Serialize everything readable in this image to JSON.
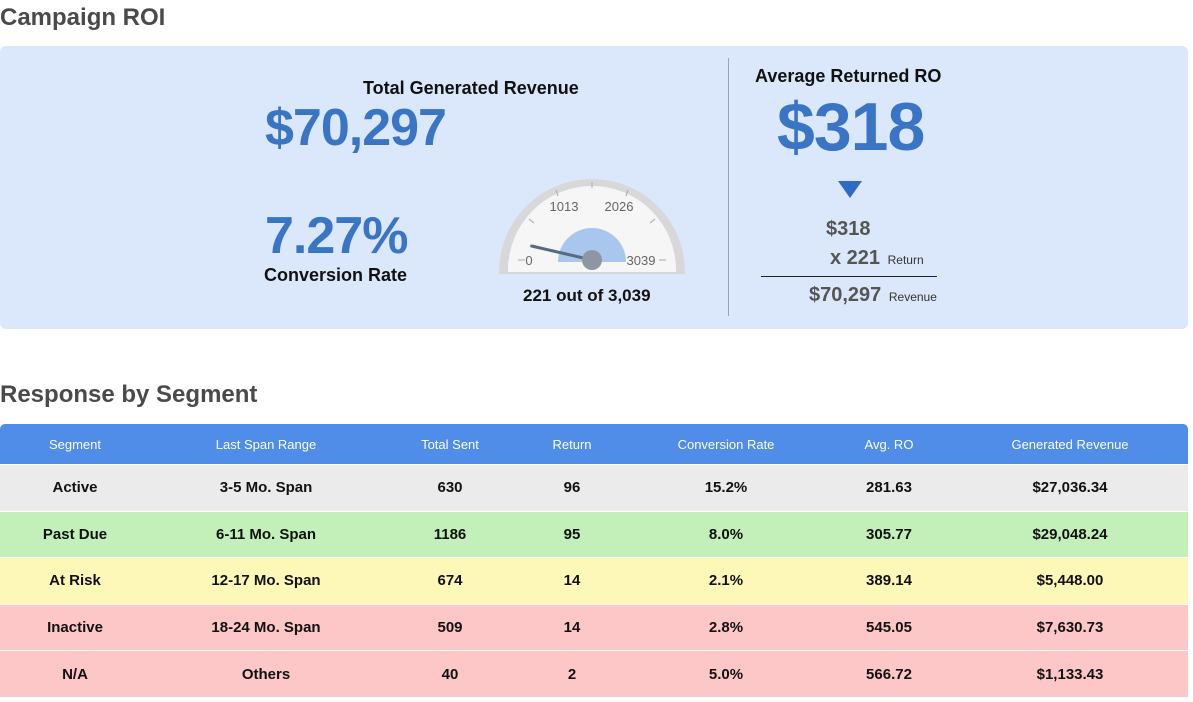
{
  "roi": {
    "section_title": "Campaign ROI",
    "total_label": "Total Generated Revenue",
    "total_value": "$70,297",
    "conversion_value": "7.27%",
    "conversion_label": "Conversion Rate",
    "gauge": {
      "min": "0",
      "tick1": "1013",
      "tick2": "2026",
      "max": "3039",
      "value": 221,
      "max_value": 3039,
      "caption": "221 out of 3,039"
    },
    "avg_label": "Average Returned RO",
    "avg_value": "$318",
    "calc": {
      "avg": "$318",
      "times": "x 221",
      "times_suffix": "Return",
      "result": "$70,297",
      "result_suffix": "Revenue"
    }
  },
  "segments": {
    "section_title": "Response by Segment",
    "headers": [
      "Segment",
      "Last Span Range",
      "Total Sent",
      "Return",
      "Conversion Rate",
      "Avg. RO",
      "Generated Revenue"
    ],
    "rows": [
      [
        "Active",
        "3-5 Mo. Span",
        "630",
        "96",
        "15.2%",
        "281.63",
        "$27,036.34"
      ],
      [
        "Past Due",
        "6-11 Mo. Span",
        "1186",
        "95",
        "8.0%",
        "305.77",
        "$29,048.24"
      ],
      [
        "At Risk",
        "12-17 Mo. Span",
        "674",
        "14",
        "2.1%",
        "389.14",
        "$5,448.00"
      ],
      [
        "Inactive",
        "18-24 Mo. Span",
        "509",
        "14",
        "2.8%",
        "545.05",
        "$7,630.73"
      ],
      [
        "N/A",
        "Others",
        "40",
        "2",
        "5.0%",
        "566.72",
        "$1,133.43"
      ]
    ]
  },
  "colors": {
    "accent": "#3a74c4",
    "panel": "#dbe8fc",
    "header": "#4f8de8",
    "row_active": "#ebebeb",
    "row_past_due": "#c3f0b9",
    "row_at_risk": "#fdf8b8",
    "row_inactive": "#fdc7c7",
    "row_na": "#fdc7c7"
  }
}
